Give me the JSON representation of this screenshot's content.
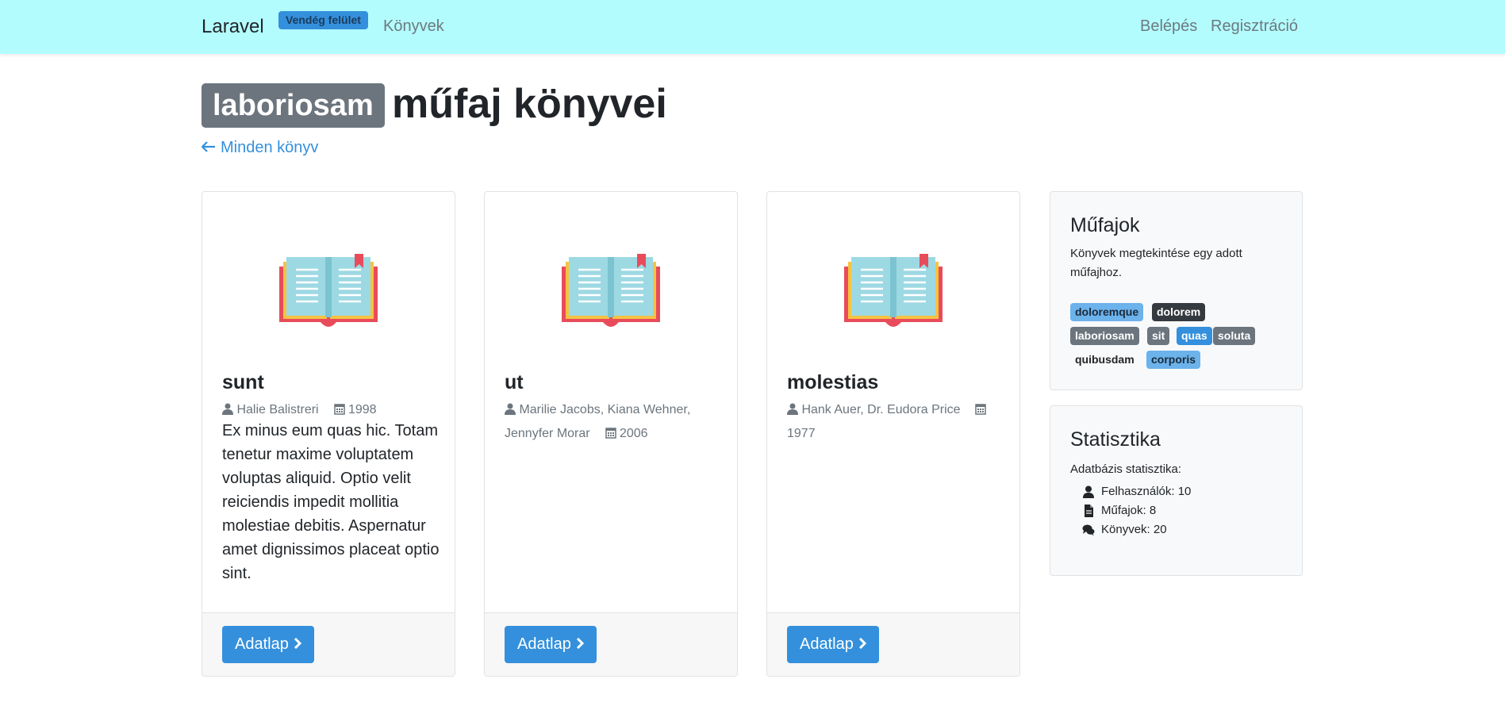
{
  "navbar": {
    "brand": "Laravel",
    "badge": "Vendég felület",
    "books_link": "Könyvek",
    "login_link": "Belépés",
    "register_link": "Regisztráció",
    "background": "#b3fcfd"
  },
  "header": {
    "genre": "laboriosam",
    "title": "műfaj könyvei",
    "back_link": "Minden könyv"
  },
  "books": [
    {
      "title": "sunt",
      "authors": "Halie Balistreri",
      "year": "1998",
      "description": "Ex minus eum quas hic. Totam tenetur maxime voluptatem voluptas aliquid. Optio velit reiciendis impedit mollitia molestiae debitis. Aspernatur amet dignissimos placeat optio sint.",
      "button": "Adatlap"
    },
    {
      "title": "ut",
      "authors": "Marilie Jacobs, Kiana Wehner, Jennyfer Morar",
      "year": "2006",
      "description": "",
      "button": "Adatlap"
    },
    {
      "title": "molestias",
      "authors": "Hank Auer, Dr. Eudora Price",
      "year": "1977",
      "description": "",
      "button": "Adatlap"
    }
  ],
  "sidebar": {
    "genres": {
      "title": "Műfajok",
      "text": "Könyvek megtekintése egy adott műfajhoz.",
      "tags": [
        "doloremque",
        "dolorem",
        "laboriosam",
        "sit",
        "quas",
        "soluta",
        "quibusdam",
        "corporis"
      ]
    },
    "stats": {
      "title": "Statisztika",
      "text": "Adatbázis statisztika:",
      "users": "Felhasználók: 10",
      "genres": "Műfajok: 8",
      "books": "Könyvek: 20"
    }
  },
  "colors": {
    "primary": "#3490dc",
    "secondary": "#6c757d",
    "dark": "#343a40",
    "light_blue": "#6cb2eb"
  },
  "icons": {
    "back": "arrow-left-icon",
    "author": "user-icon",
    "year": "calendar-icon",
    "button": "chevron-right-icon",
    "book": "open-book-icon",
    "users": "user-icon",
    "genres": "file-icon",
    "books": "comments-icon"
  }
}
